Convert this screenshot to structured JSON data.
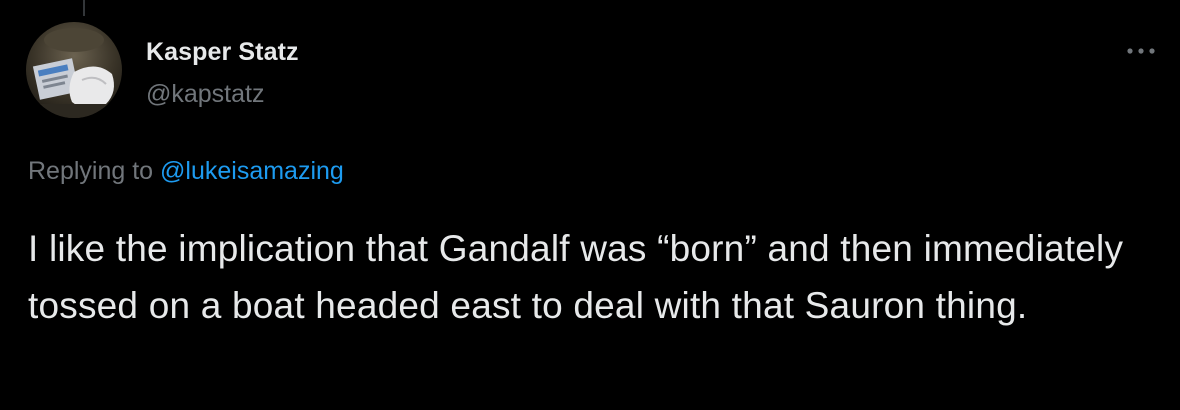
{
  "tweet": {
    "author": {
      "display_name": "Kasper Statz",
      "handle": "@kapstatz",
      "avatar_icon": "avatar-photo"
    },
    "more_icon": "ellipsis-icon",
    "reply_prefix": "Replying to",
    "reply_to": "@lukeisamazing",
    "text": "I like the implication that Gandalf was “born” and then immediately tossed on a boat headed east to deal with that Sauron thing."
  },
  "colors": {
    "background": "#000000",
    "primary_text": "#e7e9ea",
    "secondary_text": "#71767b",
    "link": "#1d9bf0"
  }
}
